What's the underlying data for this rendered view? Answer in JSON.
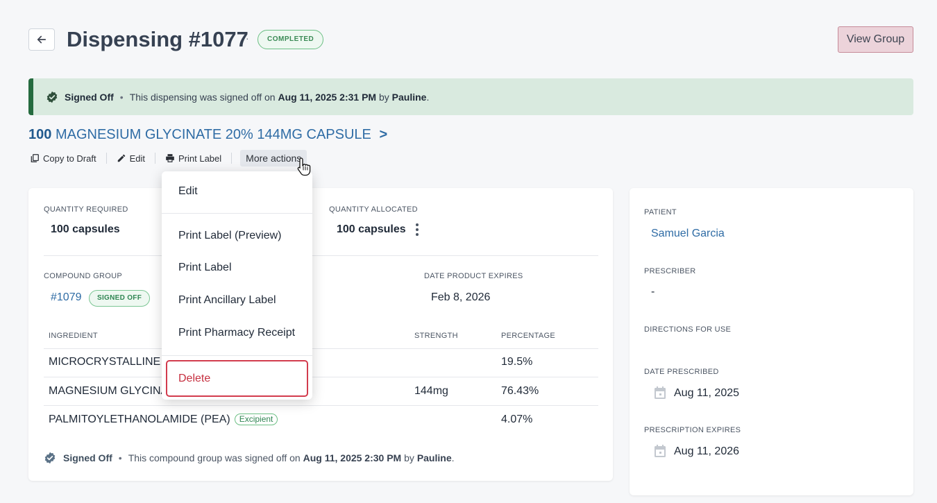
{
  "header": {
    "title": "Dispensing #1077",
    "dot": "·",
    "status": "COMPLETED",
    "view_group": "View Group"
  },
  "banner": {
    "label": "Signed Off",
    "sep": "•",
    "text_pre": "This dispensing was signed off on",
    "date": "Aug 11, 2025 2:31 PM",
    "by": "by",
    "user": "Pauline",
    "end": "."
  },
  "product": {
    "qty": "100",
    "name": "MAGNESIUM GLYCINATE 20% 144MG CAPSULE",
    "chevron": ">"
  },
  "actions": {
    "copy": "Copy to Draft",
    "edit": "Edit",
    "print": "Print Label",
    "more": "More actions"
  },
  "main": {
    "qty_required_label": "QUANTITY REQUIRED",
    "qty_required": "100 capsules",
    "qty_allocated_label": "QUANTITY ALLOCATED",
    "qty_allocated": "100 capsules",
    "compound_group_label": "COMPOUND GROUP",
    "compound_group": "#1079",
    "compound_status": "SIGNED OFF",
    "expires_label": "DATE PRODUCT EXPIRES",
    "expires": "Feb 8, 2026",
    "table": {
      "headers": [
        "INGREDIENT",
        "STRENGTH",
        "PERCENTAGE"
      ],
      "rows": [
        {
          "ingredient": "MICROCRYSTALLINE C",
          "strength": "",
          "percentage": "19.5%",
          "badge": ""
        },
        {
          "ingredient": "MAGNESIUM GLYCINA",
          "strength": "144mg",
          "percentage": "76.43%",
          "badge": ""
        },
        {
          "ingredient": "PALMITOYLETHANOLAMIDE (PEA)",
          "strength": "",
          "percentage": "4.07%",
          "badge": "Excipient"
        }
      ]
    },
    "footer": {
      "label": "Signed Off",
      "sep": "•",
      "text_pre": "This compound group was signed off on",
      "date": "Aug 11, 2025 2:30 PM",
      "by": "by",
      "user": "Pauline",
      "end": "."
    }
  },
  "side": {
    "patient_label": "PATIENT",
    "patient": "Samuel Garcia",
    "prescriber_label": "PRESCRIBER",
    "prescriber": "-",
    "directions_label": "DIRECTIONS FOR USE",
    "date_prescribed_label": "DATE PRESCRIBED",
    "date_prescribed": "Aug 11, 2025",
    "rx_expires_label": "PRESCRIPTION EXPIRES",
    "rx_expires": "Aug 11, 2026"
  },
  "menu": {
    "items": [
      "Edit",
      "Print Label (Preview)",
      "Print Label",
      "Print Ancillary Label",
      "Print Pharmacy Receipt"
    ],
    "delete": "Delete"
  },
  "colors": {
    "accent": "#2f6ca5",
    "success": "#256b3f",
    "danger": "#d23b4d",
    "view_group_bg": "#ecd3da"
  }
}
